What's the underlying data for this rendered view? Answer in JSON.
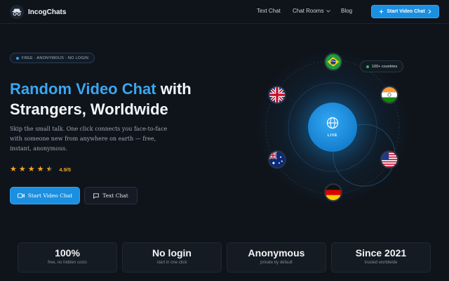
{
  "nav": {
    "brand": "IncogChats",
    "links": [
      "Text Chat",
      "Chat Rooms",
      "Blog"
    ],
    "cta": "Start Video Chat"
  },
  "hero": {
    "badge": "FREE · ANONYMOUS · NO LOGIN",
    "title_accent": "Random Video Chat",
    "title_rest_1": " with",
    "title_rest_2": "Strangers, Worldwide",
    "subtitle": "Skip the small talk. One click connects you face-to-face with someone new from anywhere on earth — free, instant, anonymous.",
    "rating": "4.9/5",
    "stars": 4.5,
    "primary_button": "Start Video Chat",
    "secondary_button": "Text Chat"
  },
  "orbit": {
    "countries_label": "100+ countries",
    "live_label": "LIVE",
    "flags": [
      "brazil",
      "united-kingdom",
      "india",
      "australia",
      "united-states",
      "germany"
    ]
  },
  "stats": [
    {
      "value": "100%",
      "label": "free, no hidden costs"
    },
    {
      "value": "No login",
      "label": "start in one click"
    },
    {
      "value": "Anonymous",
      "label": "private by default"
    },
    {
      "value": "Since 2021",
      "label": "trusted worldwide"
    }
  ],
  "colors": {
    "background": "#0f141b",
    "accent": "#1b8fe0",
    "accent_text": "#3aa6f0",
    "star": "#f5a623"
  }
}
